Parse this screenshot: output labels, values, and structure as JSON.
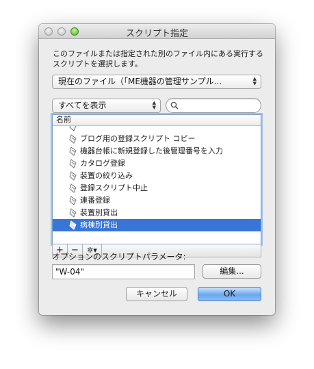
{
  "window": {
    "title": "スクリプト指定"
  },
  "description": "このファイルまたは指定された別のファイル内にある実行するスクリプトを選択します。",
  "file_popup": {
    "selected": "現在のファイル（「ME機器の管理サンプル..."
  },
  "filter_popup": {
    "selected": "すべてを表示"
  },
  "search": {
    "value": "",
    "placeholder": ""
  },
  "list": {
    "header": "名前",
    "items": [
      {
        "label": "ブログ用の登録スクリプト コピー",
        "selected": false
      },
      {
        "label": "機器台帳に新規登録した後管理番号を入力",
        "selected": false
      },
      {
        "label": "カタログ登録",
        "selected": false
      },
      {
        "label": "装置の絞り込み",
        "selected": false
      },
      {
        "label": "登録スクリプト中止",
        "selected": false
      },
      {
        "label": "連番登録",
        "selected": false
      },
      {
        "label": "装置別貸出",
        "selected": false
      },
      {
        "label": "病棟別貸出",
        "selected": true
      }
    ]
  },
  "footer": {
    "add": "+",
    "remove": "−",
    "action": "✲▾"
  },
  "options": {
    "label": "オプションのスクリプトパラメータ:",
    "value": "\"W-04\"",
    "edit_label": "編集..."
  },
  "buttons": {
    "cancel": "キャンセル",
    "ok": "OK"
  },
  "colors": {
    "selection": "#3875d7",
    "default_button": "#6aa8ee"
  }
}
